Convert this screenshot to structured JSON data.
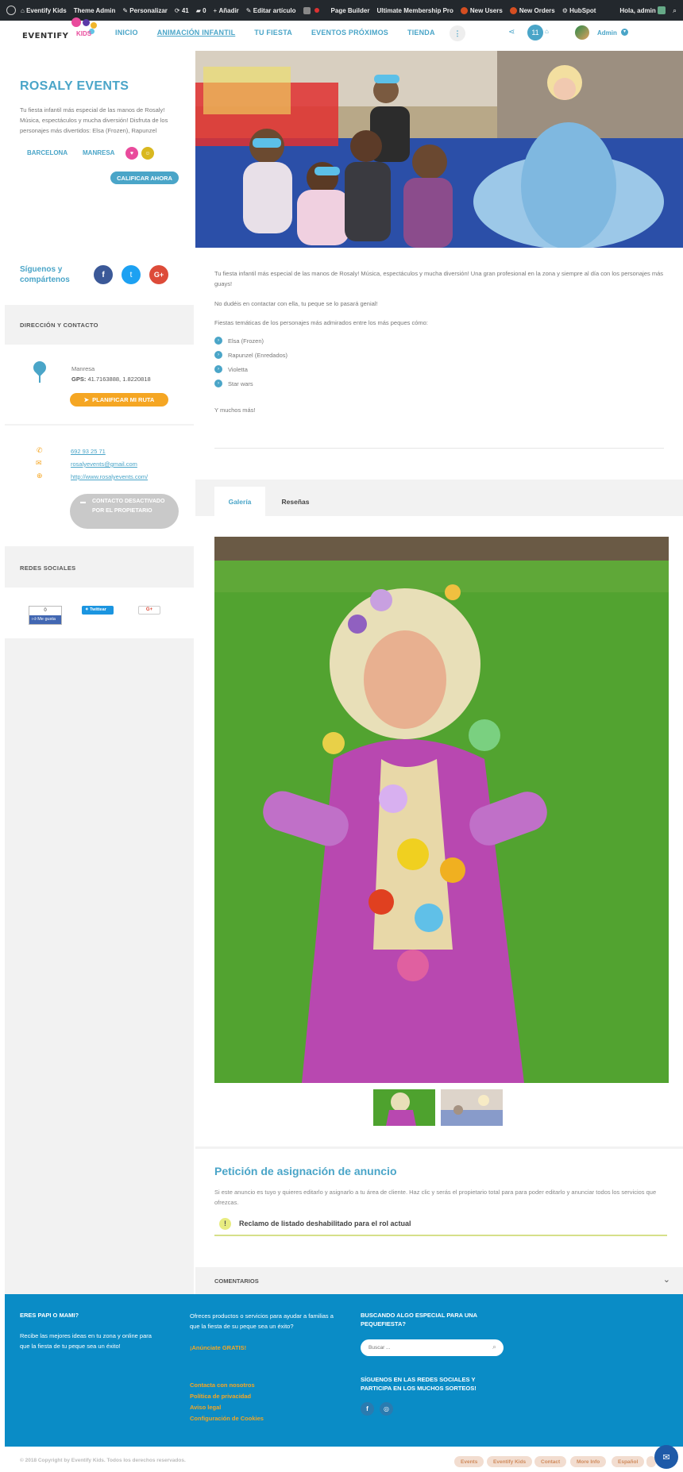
{
  "admin_bar": {
    "site_name": "Eventify Kids",
    "theme_admin": "Theme Admin",
    "personalizar": "Personalizar",
    "updates_count": "41",
    "comments_count": "0",
    "add_new": "Añadir",
    "edit_article": "Editar artículo",
    "page_builder": "Page Builder",
    "membership": "Ultimate Membership Pro",
    "new_users": "New Users",
    "new_orders": "New Orders",
    "hubspot": "HubSpot",
    "greeting": "Hola, admin"
  },
  "logo": {
    "word": "EVENTIFY",
    "kids": "KIDS"
  },
  "nav": {
    "items": [
      "INICIO",
      "ANIMACIÓN INFANTIL",
      "TU FIESTA",
      "EVENTOS PRÓXIMOS",
      "TIENDA"
    ],
    "more": "⋮",
    "cart_count": "11",
    "user_label": "Admin"
  },
  "listing": {
    "title": "ROSALY EVENTS",
    "short_desc": "Tu fiesta infantil más especial de las manos de Rosaly! Música, espectáculos y mucha diversión! Disfruta de los personajes más divertidos: Elsa (Frozen), Rapunzel",
    "tags": [
      "BARCELONA",
      "MANRESA"
    ],
    "rate_button": "CALIFICAR AHORA",
    "follow_label": "Síguenos y compártenos",
    "address_section": "DIRECCIÓN Y CONTACTO",
    "city": "Manresa",
    "gps_label": "GPS:",
    "gps_value": "41.7163888, 1.8220818",
    "route_button": "PLANIFICAR MI RUTA",
    "phone": "692 93 25 71",
    "email": "rosalyevents@gmail.com",
    "website": "http://www.rosalyevents.com/",
    "contact_button": "CONTACTO DESACTIVADO POR EL PROPIETARIO",
    "social_section": "REDES SOCIALES",
    "fb_count": "0",
    "fb_like": "Me gusta",
    "twitter_label": "Twittear",
    "gplus_label": "G+"
  },
  "content": {
    "p1": "Tu fiesta infantil más especial de las manos de Rosaly! Música, espectáculos y mucha diversión! Una gran profesional en la zona y siempre al día con los personajes más guays!",
    "p2": "No dudéis en contactar con ella, tu peque se lo pasará genial!",
    "p3": "Fiestas temáticas de los personajes más admirados entre los más peques cómo:",
    "bullets": [
      "Elsa (Frozen)",
      "Rapunzel (Enredados)",
      "Violetta",
      "Star wars"
    ],
    "p4": "Y muchos más!"
  },
  "tabs": {
    "gallery": "Galería",
    "reviews": "Reseñas"
  },
  "claim": {
    "title": "Petición de asignación de anuncio",
    "text": "Si este anuncio es tuyo y quieres editarlo y asignarlo a tu área de cliente. Haz clic y serás el propietario total para para poder editarlo y anunciar todos los servicios que ofrezcas.",
    "notice": "Reclamo de listado deshabilitado para el rol actual"
  },
  "comments_label": "COMENTARIOS",
  "footer": {
    "col1_title": "ERES PAPI O MAMI?",
    "col1_text": "Recibe las mejores ideas en tu zona y online para que la fiesta de tu peque sea un éxito!",
    "col2_text": "Ofreces productos o servicios para ayudar a familias a que la fiesta de su peque sea un éxito?",
    "col2_link": "¡Anúnciate GRATIS!",
    "links": [
      "Contacta con nosotros",
      "Política de privacidad",
      "Aviso legal",
      "Configuración de Cookies"
    ],
    "col3_title": "BUSCANDO ALGO ESPECIAL PARA UNA PEQUEFIESTA?",
    "search_placeholder": "Buscar ...",
    "col3_social": "SÍGUENOS EN LAS REDES SOCIALES Y PARTICIPA EN LOS MUCHOS SORTEOS!"
  },
  "bottom": {
    "copyright": "© 2018 Copyright by Eventify Kids. Todos los derechos reservados.",
    "pills": [
      "Events",
      "Eventify Kids",
      "Contact",
      "More Info",
      "Español"
    ]
  },
  "colors": {
    "accent": "#4aa5c8",
    "orange": "#f5a623",
    "footer": "#0a8cc6",
    "admin_bar": "#23282d"
  }
}
